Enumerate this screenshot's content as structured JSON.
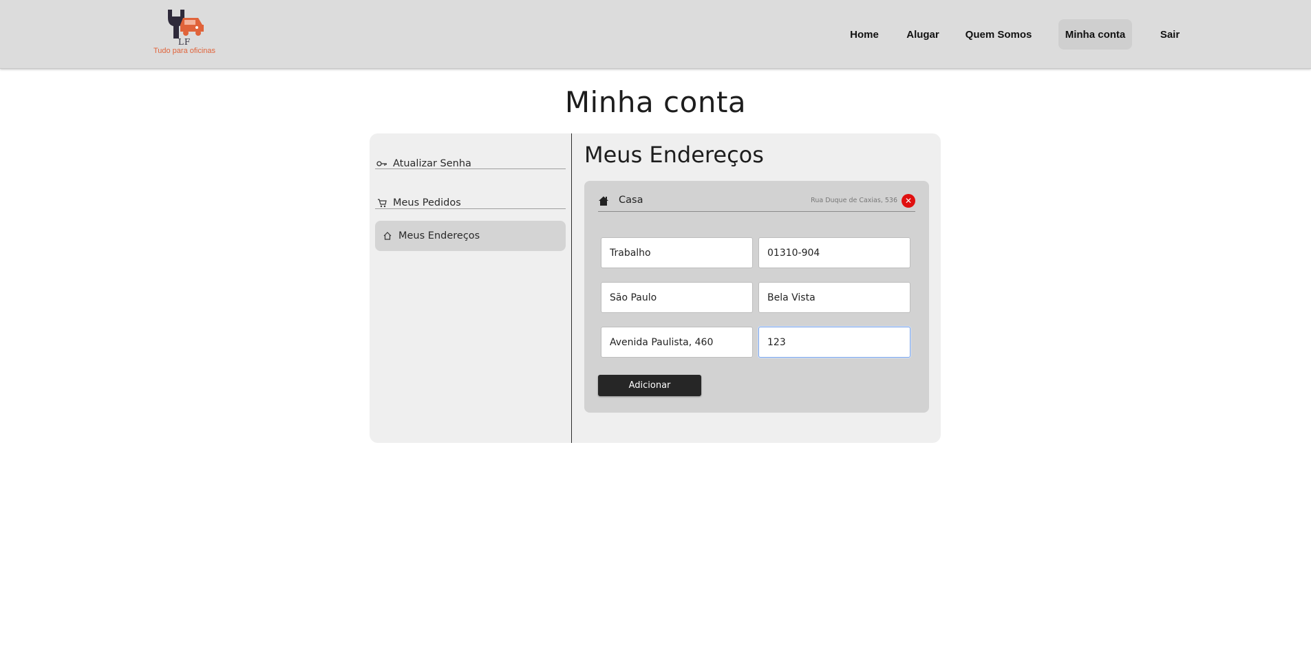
{
  "brand": {
    "logo_text": "LF",
    "tagline": "Tudo para oficinas",
    "colors": {
      "primary": "#2e2a3a",
      "accent": "#e0633a"
    }
  },
  "nav": {
    "items": [
      {
        "label": "Home",
        "active": false
      },
      {
        "label": "Alugar",
        "active": false
      },
      {
        "label": "Quem Somos",
        "active": false
      },
      {
        "label": "Minha conta",
        "active": true
      },
      {
        "label": "Sair",
        "active": false
      }
    ]
  },
  "page": {
    "title": "Minha conta"
  },
  "sidebar": {
    "items": [
      {
        "label": "Atualizar Senha",
        "icon": "key-icon",
        "active": false
      },
      {
        "label": "Meus Pedidos",
        "icon": "cart-icon",
        "active": false
      },
      {
        "label": "Meus Endereços",
        "icon": "home-outline-icon",
        "active": true
      }
    ]
  },
  "addresses": {
    "title": "Meus Endereços",
    "saved": [
      {
        "name": "Casa",
        "summary": "Rua Duque de Caxias, 536",
        "icon": "home-filled-icon",
        "delete_icon": "close-icon",
        "delete_color": "#e01010"
      }
    ],
    "form": {
      "label_value": "Trabalho",
      "cep_value": "01310-904",
      "city_value": "São Paulo",
      "district_value": "Bela Vista",
      "street_value": "Avenida Paulista, 460",
      "number_value": "123",
      "submit_label": "Adicionar"
    }
  }
}
